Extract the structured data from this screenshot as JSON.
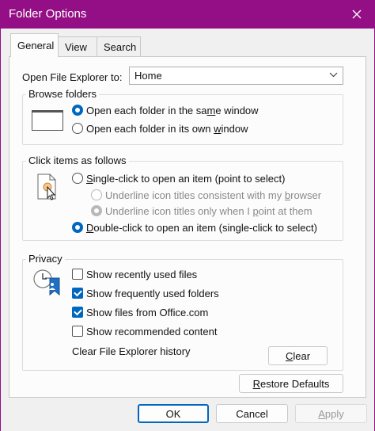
{
  "window": {
    "title": "Folder Options"
  },
  "tabs": [
    {
      "label": "General"
    },
    {
      "label": "View"
    },
    {
      "label": "Search"
    }
  ],
  "open_to": {
    "label": "Open File Explorer to:",
    "value": "Home"
  },
  "browse": {
    "title": "Browse folders",
    "opt1": {
      "pre": "Open each folder in the sa",
      "u": "m",
      "post": "e window"
    },
    "opt2": {
      "pre": "Open each folder in its own ",
      "u": "w",
      "post": "indow"
    }
  },
  "click": {
    "title": "Click items as follows",
    "single": {
      "u": "S",
      "post": "ingle-click to open an item (point to select)"
    },
    "under1": {
      "pre": "Underline icon titles consistent with my ",
      "u": "b",
      "post": "rowser"
    },
    "under2": {
      "pre": "Underline icon titles only when I ",
      "u": "p",
      "post": "oint at them"
    },
    "double": {
      "u": "D",
      "post": "ouble-click to open an item (single-click to select)"
    }
  },
  "privacy": {
    "title": "Privacy",
    "items": [
      {
        "label": "Show recently used files",
        "checked": false
      },
      {
        "label": "Show frequently used folders",
        "checked": true
      },
      {
        "label": "Show files from Office.com",
        "checked": true
      },
      {
        "label": "Show recommended content",
        "checked": false
      }
    ],
    "clear_label": "Clear File Explorer history",
    "clear_button": {
      "pre": "",
      "u": "C",
      "post": "lear"
    }
  },
  "buttons": {
    "restore": {
      "u": "R",
      "post": "estore Defaults"
    },
    "ok": "OK",
    "cancel": "Cancel",
    "apply": {
      "u": "A",
      "post": "pply"
    }
  },
  "colors": {
    "accent": "#0067c0",
    "titlebar": "#940f86"
  }
}
